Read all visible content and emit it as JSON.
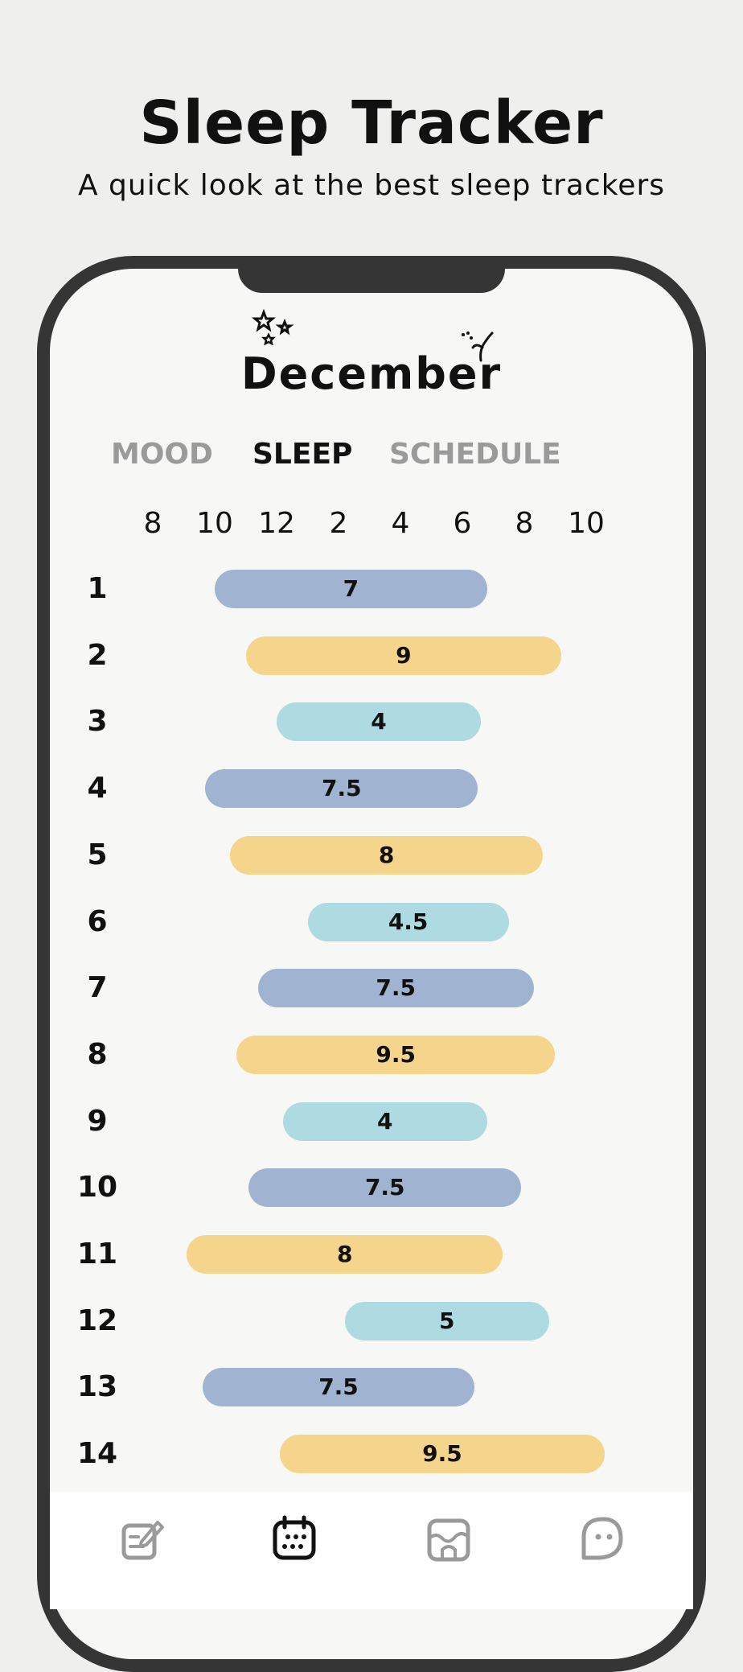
{
  "header": {
    "title": "Sleep Tracker",
    "subtitle": "A quick look at the best sleep trackers"
  },
  "app": {
    "month": "December",
    "tabs": [
      {
        "label": "MOOD",
        "active": false
      },
      {
        "label": "SLEEP",
        "active": true
      },
      {
        "label": "SCHEDULE",
        "active": false
      }
    ],
    "hour_labels": [
      "8",
      "10",
      "12",
      "2",
      "4",
      "6",
      "8",
      "10"
    ],
    "colors": {
      "blue": "#a0b4d2",
      "yellow": "#f5d48b",
      "teal": "#aedbe2"
    },
    "nav": [
      {
        "icon": "edit-note-icon",
        "active": false
      },
      {
        "icon": "calendar-icon",
        "active": true
      },
      {
        "icon": "storefront-icon",
        "active": false
      },
      {
        "icon": "ghost-icon",
        "active": false
      }
    ]
  },
  "chart_data": {
    "type": "bar",
    "categories": [
      "1",
      "2",
      "3",
      "4",
      "5",
      "6",
      "7",
      "8",
      "9",
      "10",
      "11",
      "12",
      "13",
      "14"
    ],
    "x_ticks": [
      "8",
      "10",
      "12",
      "2",
      "4",
      "6",
      "8",
      "10"
    ],
    "series": [
      {
        "values": [
          7,
          9,
          4,
          7.5,
          8,
          4.5,
          7.5,
          9.5,
          4,
          7.5,
          8,
          5,
          7.5,
          9.5
        ],
        "start_hour": [
          22,
          23,
          24,
          21.7,
          22.5,
          25,
          23.4,
          22.7,
          24.2,
          23.1,
          21.1,
          26.2,
          21.6,
          24.1
        ],
        "end_hour": [
          30.8,
          33.2,
          30.6,
          30.5,
          32.6,
          31.5,
          32.3,
          33,
          30.8,
          31.9,
          31.3,
          32.8,
          30.4,
          34.6
        ],
        "color": [
          "blue",
          "yellow",
          "teal",
          "blue",
          "yellow",
          "teal",
          "blue",
          "yellow",
          "teal",
          "blue",
          "yellow",
          "teal",
          "blue",
          "yellow"
        ]
      }
    ]
  }
}
